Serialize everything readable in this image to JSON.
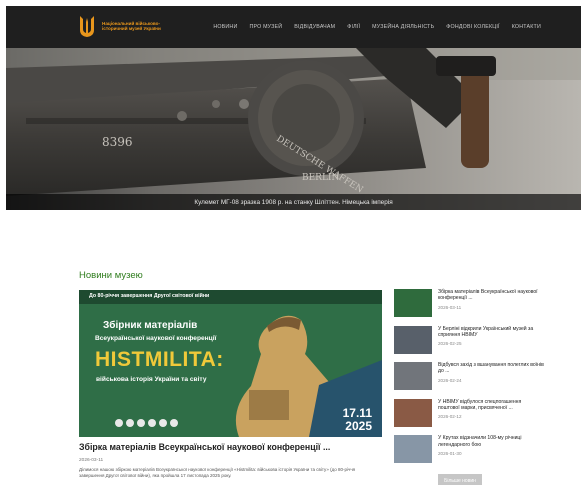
{
  "header": {
    "logo_text": "Національний військово-історичний музей України",
    "nav": [
      "НОВИНИ",
      "ПРО МУЗЕЙ",
      "ВІДВІДУВАЧАМ",
      "ФІЛІЇ",
      "МУЗЕЙНА ДІЯЛЬНІСТЬ",
      "ФОНДОВІ КОЛЕКЦІЇ",
      "КОНТАКТИ"
    ]
  },
  "hero": {
    "caption": "Кулемет МГ-08 зразка 1908 р. на станку Шліттен. Німецька імперія",
    "engraving_number": "8396",
    "engraving_maker": "DEUTSCHE WAFFEN",
    "engraving_city": "BERLIN"
  },
  "news": {
    "section_title": "Новини музею",
    "feature": {
      "poster_top": "До 80-річчя завершення Другої світової війни",
      "poster_line1": "Збірник матеріалів",
      "poster_line2": "Всеукраїнської наукової конференції",
      "poster_line3": "HISTMILITA:",
      "poster_line4": "військова історія України та світу",
      "poster_date1": "17.11",
      "poster_date2": "2025",
      "title": "Збірка матеріалів Всеукраїнської наукової конференції ...",
      "date": "2026-03-11",
      "text": "Ділимося нашою збіркою матеріалів Всеукраїнської наукової конференції «Histmilita: військова історія України та світу» (до 80-річчя завершення Другої світової війни), яка пройшла 17 листопада 2025 року."
    },
    "items": [
      {
        "title": "Збірка матеріалів Всеукраїнської наукової конференції ...",
        "date": "2026-03-11",
        "color": "#2f6b3d"
      },
      {
        "title": "У Берліні відкрили Український музей за сприяння НВІМУ",
        "date": "2026-02-25",
        "color": "#58606a"
      },
      {
        "title": "Відбувся захід з вшанування полеглих воїнів до ...",
        "date": "2026-02-24",
        "color": "#71757b"
      },
      {
        "title": "У НВІМУ відбулося спецпогашення поштової марки, присвяченої ...",
        "date": "2026-02-12",
        "color": "#8a5a45"
      },
      {
        "title": "У Крутах відзначили 108-му річниці легендарного бою",
        "date": "2026-01-30",
        "color": "#8796a6"
      }
    ],
    "more_label": "Більше новин"
  }
}
